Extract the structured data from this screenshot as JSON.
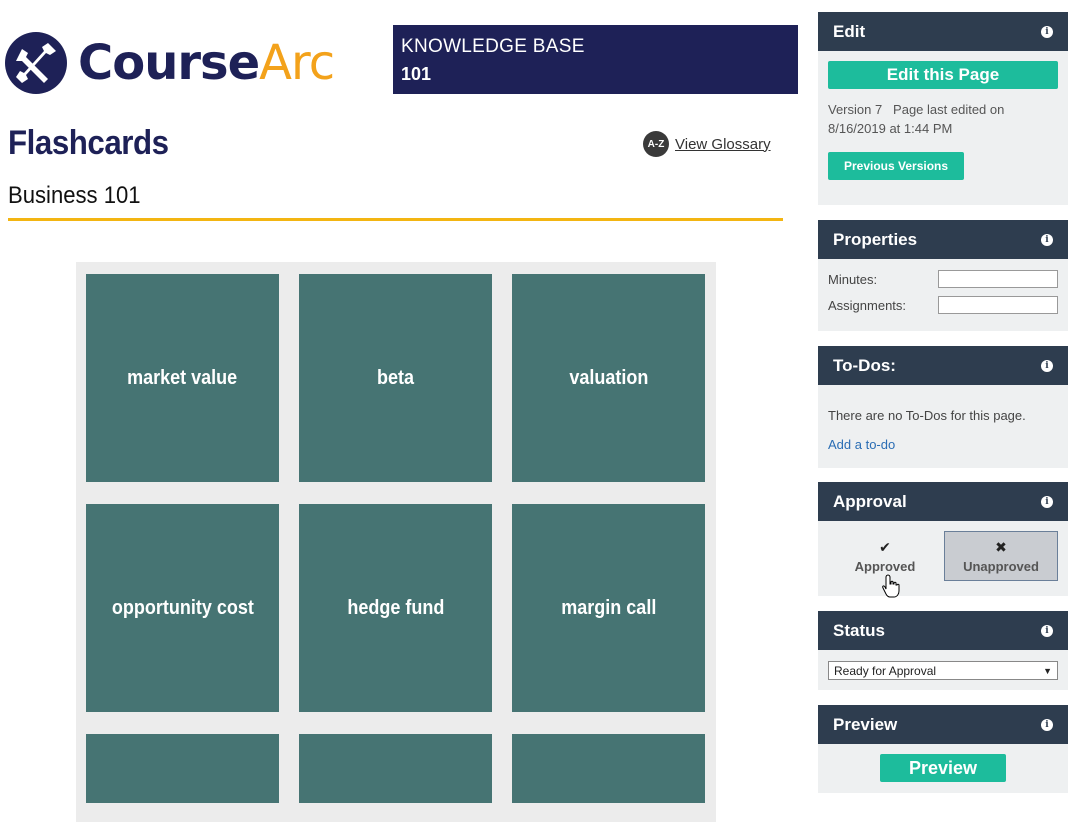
{
  "header": {
    "logo_course": "Course",
    "logo_arc": "Arc",
    "kb_line1": "KNOWLEDGE BASE",
    "kb_line2": "101"
  },
  "page": {
    "title": "Flashcards",
    "subtitle": "Business 101",
    "glossary_icon_text": "A-Z",
    "glossary_label": "View Glossary"
  },
  "cards": [
    "market value",
    "beta",
    "valuation",
    "opportunity cost",
    "hedge fund",
    "margin call",
    "",
    "",
    ""
  ],
  "panels": {
    "edit": {
      "title": "Edit",
      "button": "Edit this Page",
      "meta": "Version 7   Page last edited on 8/16/2019 at 1:44 PM",
      "previous_button": "Previous Versions"
    },
    "properties": {
      "title": "Properties",
      "minutes_label": "Minutes:",
      "minutes_value": "",
      "assignments_label": "Assignments:",
      "assignments_value": ""
    },
    "todos": {
      "title": "To-Dos:",
      "empty_text": "There are no To-Dos for this page.",
      "add_link": "Add a to-do"
    },
    "approval": {
      "title": "Approval",
      "approved_label": "Approved",
      "unapproved_label": "Unapproved",
      "approved_glyph": "✔",
      "unapproved_glyph": "✖"
    },
    "status": {
      "title": "Status",
      "selected": "Ready for Approval"
    },
    "preview": {
      "title": "Preview",
      "button": "Preview"
    }
  },
  "colors": {
    "brand_navy": "#1e2157",
    "brand_orange": "#f3a21b",
    "card_teal": "#467473",
    "panel_head": "#2e3d4f",
    "button_green": "#1dbc9c",
    "gold_rule": "#f3b512"
  }
}
